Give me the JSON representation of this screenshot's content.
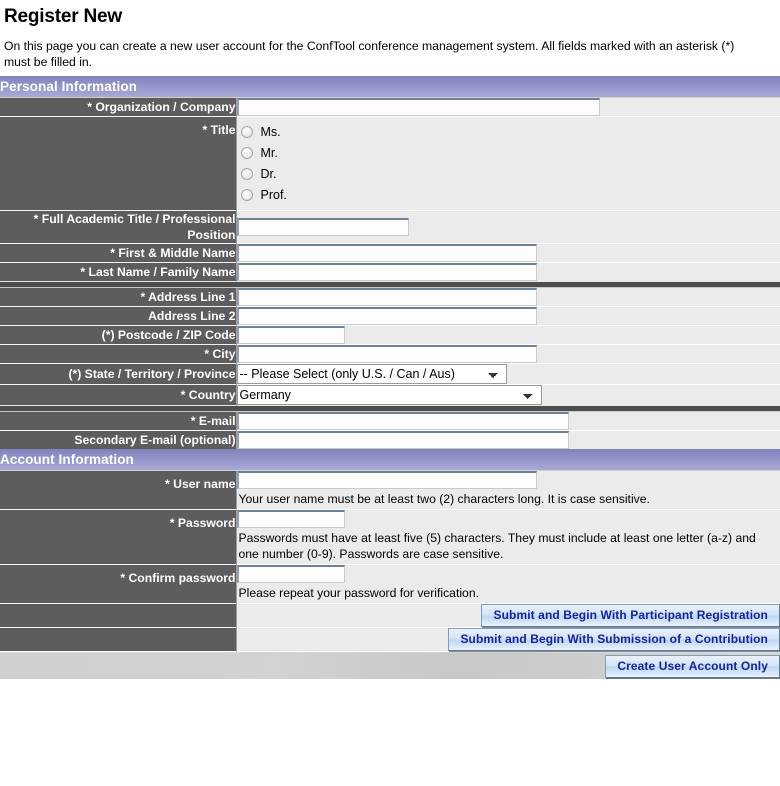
{
  "page": {
    "title": "Register New",
    "intro": "On this page you can create a new user account for the ConfTool conference management system. All fields marked with an asterisk (*) must be filled in."
  },
  "sections": {
    "personal": {
      "heading": "Personal Information"
    },
    "account": {
      "heading": "Account Information"
    }
  },
  "fields": {
    "organization": {
      "label": "* Organization / Company",
      "value": "",
      "placeholder": ""
    },
    "title": {
      "label": "* Title",
      "options": [
        {
          "label": "Ms.",
          "selected": false
        },
        {
          "label": "Mr.",
          "selected": false
        },
        {
          "label": "Dr.",
          "selected": false
        },
        {
          "label": "Prof.",
          "selected": false
        }
      ]
    },
    "academic_title": {
      "label": "* Full Academic Title / Professional Position",
      "value": "",
      "placeholder": ""
    },
    "first_name": {
      "label": "* First & Middle Name",
      "value": "",
      "placeholder": ""
    },
    "last_name": {
      "label": "* Last Name / Family Name",
      "value": "",
      "placeholder": ""
    },
    "address1": {
      "label": "* Address Line 1",
      "value": "",
      "placeholder": ""
    },
    "address2": {
      "label": "Address Line 2",
      "value": "",
      "placeholder": ""
    },
    "postcode": {
      "label": "(*) Postcode / ZIP Code",
      "value": "",
      "placeholder": ""
    },
    "city": {
      "label": "* City",
      "value": "",
      "placeholder": ""
    },
    "state": {
      "label": "(*) State / Territory / Province",
      "selected": "-- Please Select (only U.S. / Can / Aus)",
      "options": [
        "-- Please Select (only U.S. / Can / Aus)"
      ]
    },
    "country": {
      "label": "* Country",
      "selected": "Germany",
      "options": [
        "Germany"
      ]
    },
    "email": {
      "label": "* E-mail",
      "value": "",
      "placeholder": ""
    },
    "secondary_email": {
      "label": "Secondary E-mail (optional)",
      "value": "",
      "placeholder": ""
    },
    "username": {
      "label": "* User name",
      "value": "",
      "placeholder": "",
      "hint": "Your user name must be at least two (2) characters long. It is case sensitive."
    },
    "password": {
      "label": "* Password",
      "value": "",
      "placeholder": "",
      "hint": "Passwords must have at least five (5) characters. They must include at least one letter (a-z) and one number (0-9). Passwords are case sensitive."
    },
    "confirm_password": {
      "label": "* Confirm password",
      "value": "",
      "placeholder": "",
      "hint": "Please repeat your password for verification."
    }
  },
  "buttons": {
    "submit_participant": "Submit and Begin With Participant Registration",
    "submit_contribution": "Submit and Begin With Submission of a Contribution",
    "create_account_only": "Create User Account Only"
  },
  "colors": {
    "section_header": "#8e8fc4",
    "label_column": "#5d5d5d",
    "field_column": "#ebebeb",
    "button_text": "#12239e",
    "separator": "#4e4e4e"
  }
}
